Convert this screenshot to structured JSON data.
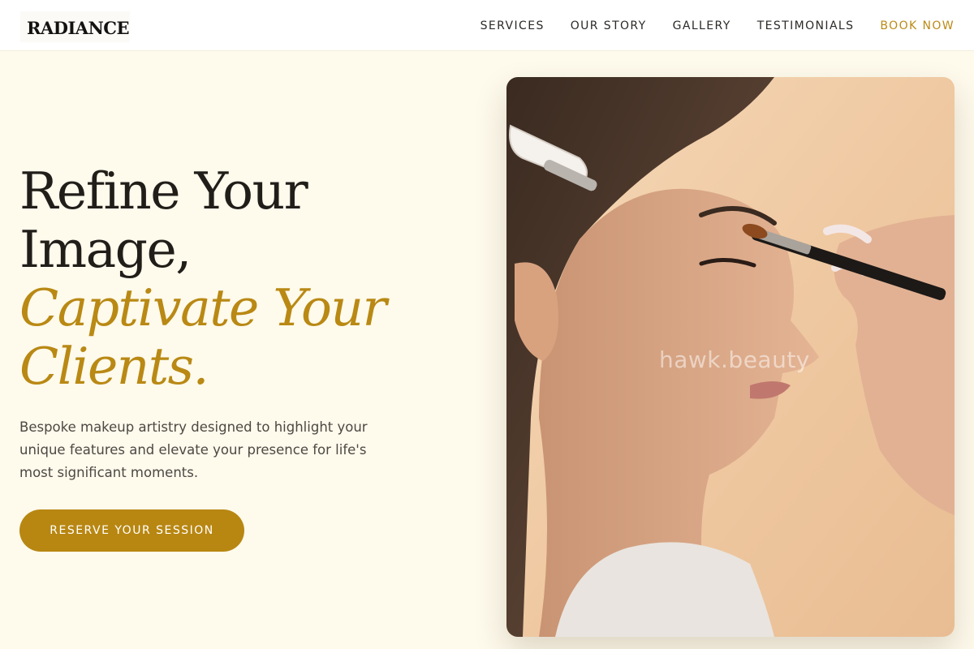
{
  "brand": {
    "logo": "RADIANCE"
  },
  "nav": {
    "items": [
      {
        "label": "SERVICES"
      },
      {
        "label": "OUR STORY"
      },
      {
        "label": "GALLERY"
      },
      {
        "label": "TESTIMONIALS"
      }
    ],
    "cta": "BOOK NOW"
  },
  "hero": {
    "title_line1": "Refine Your",
    "title_line2": "Image,",
    "title_accent1": "Captivate Your",
    "title_accent2": "Clients.",
    "subtitle": "Bespoke makeup artistry designed to highlight your unique features and elevate your presence for life's most significant moments.",
    "button": "RESERVE YOUR SESSION"
  },
  "image": {
    "watermark": "hawk.beauty",
    "icon": "makeup-portrait-photo"
  },
  "colors": {
    "background": "#fefaec",
    "accent": "#b88712",
    "text": "#211e1a"
  }
}
